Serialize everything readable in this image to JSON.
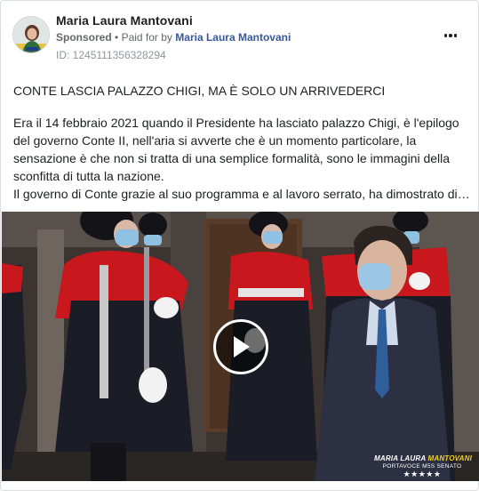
{
  "post": {
    "page_name": "Maria Laura Mantovani",
    "sponsored_label": "Sponsored",
    "separator": "•",
    "paid_for_prefix": "Paid for by",
    "paid_for_by": "Maria Laura Mantovani",
    "id_text": "ID: 1245111356328294",
    "avatar_icon": "profile-photo",
    "more_icon": "more-options-icon"
  },
  "content": {
    "headline": "CONTE LASCIA PALAZZO CHIGI, MA È SOLO UN ARRIVEDERCI",
    "body_lines": [
      "Era il 14 febbraio 2021 quando il Presidente ha lasciato palazzo Chigi, è l'epilogo",
      "del governo Conte II, nell'aria si avverte che è un momento particolare, la",
      "sensazione è che non si tratta di una semplice formalità, sono le immagini della",
      "sconfitta di tutta la nazione.",
      "Il governo di Conte grazie al suo programma e al lavoro serrato, ha dimostrato di…"
    ]
  },
  "video": {
    "watermark_first": "MARIA LAURA",
    "watermark_last": "MANTOVANI",
    "watermark_role": "PORTAVOCE M5S SENATO",
    "watermark_stars": "★★★★★",
    "play_icon": "play-icon",
    "colors": {
      "uniform_red": "#c8181e",
      "uniform_dark": "#1b1d26",
      "background": "#3a3330"
    }
  }
}
